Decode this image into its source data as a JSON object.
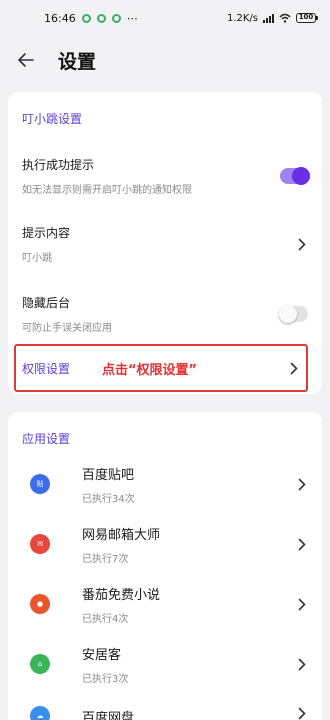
{
  "status_bar": {
    "time": "16:46",
    "dots": "⋯",
    "net_speed": "1.2K/s",
    "battery": "100"
  },
  "header": {
    "title": "设置"
  },
  "section1": {
    "title": "叮小跳设置",
    "rows": [
      {
        "title": "执行成功提示",
        "subtitle": "如无法显示则需开启叮小跳的通知权限",
        "toggle": true
      },
      {
        "title": "提示内容",
        "subtitle": "叮小跳"
      },
      {
        "title": "隐藏后台",
        "subtitle": "可防止手误关闭应用",
        "toggle": false
      }
    ],
    "permission": {
      "label": "权限设置",
      "annotation": "点击“权限设置”"
    }
  },
  "section2": {
    "title": "应用设置",
    "apps": [
      {
        "name": "百度贴吧",
        "count": "已执行34次",
        "icon": "tieba-icon",
        "color": "#3b6ee8"
      },
      {
        "name": "网易邮箱大师",
        "count": "已执行7次",
        "icon": "mail-icon",
        "color": "#e8483b"
      },
      {
        "name": "番茄免费小说",
        "count": "已执行4次",
        "icon": "fanqie-icon",
        "color": "#e9552f"
      },
      {
        "name": "安居客",
        "count": "已执行3次",
        "icon": "anjuke-icon",
        "color": "#3bb55a"
      },
      {
        "name": "百度网盘",
        "count": "",
        "icon": "netdisk-icon",
        "color": "#3a8ef0"
      }
    ]
  }
}
